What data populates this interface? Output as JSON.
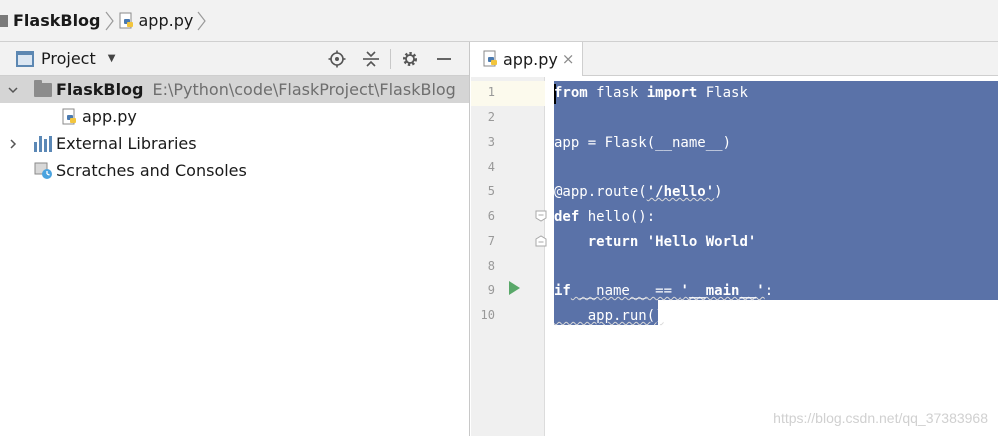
{
  "breadcrumb": {
    "project": "FlaskBlog",
    "file": "app.py"
  },
  "project_panel": {
    "title": "Project",
    "tools": [
      "locate-icon",
      "collapse-all-icon",
      "gear-icon",
      "minimize-icon"
    ],
    "tree": {
      "root_label": "FlaskBlog",
      "root_path": "E:\\Python\\code\\FlaskProject\\FlaskBlog",
      "file": "app.py",
      "external_libraries": "External Libraries",
      "scratches": "Scratches and Consoles"
    }
  },
  "editor": {
    "tab_label": "app.py",
    "tab_close": "×",
    "line_numbers": [
      "1",
      "2",
      "3",
      "4",
      "5",
      "6",
      "7",
      "8",
      "9",
      "10"
    ],
    "code": {
      "l1_kw1": "from",
      "l1_mid": " flask ",
      "l1_kw2": "import",
      "l1_end": " Flask",
      "l3": "app = Flask(__name__)",
      "l5_pre": "@app.route(",
      "l5_str": "'/hello'",
      "l5_end": ")",
      "l6_kw": "def",
      "l6_rest": " hello():",
      "l7_indent": "    ",
      "l7_kw": "return",
      "l7_str": " 'Hello World'",
      "l9_kw": "if",
      "l9_mid": " __name__ == ",
      "l9_str": "'__main__'",
      "l9_end": ":",
      "l10": "    app.run()"
    },
    "selection_color": "#5a72a8"
  },
  "watermark": "https://blog.csdn.net/qq_37383968"
}
